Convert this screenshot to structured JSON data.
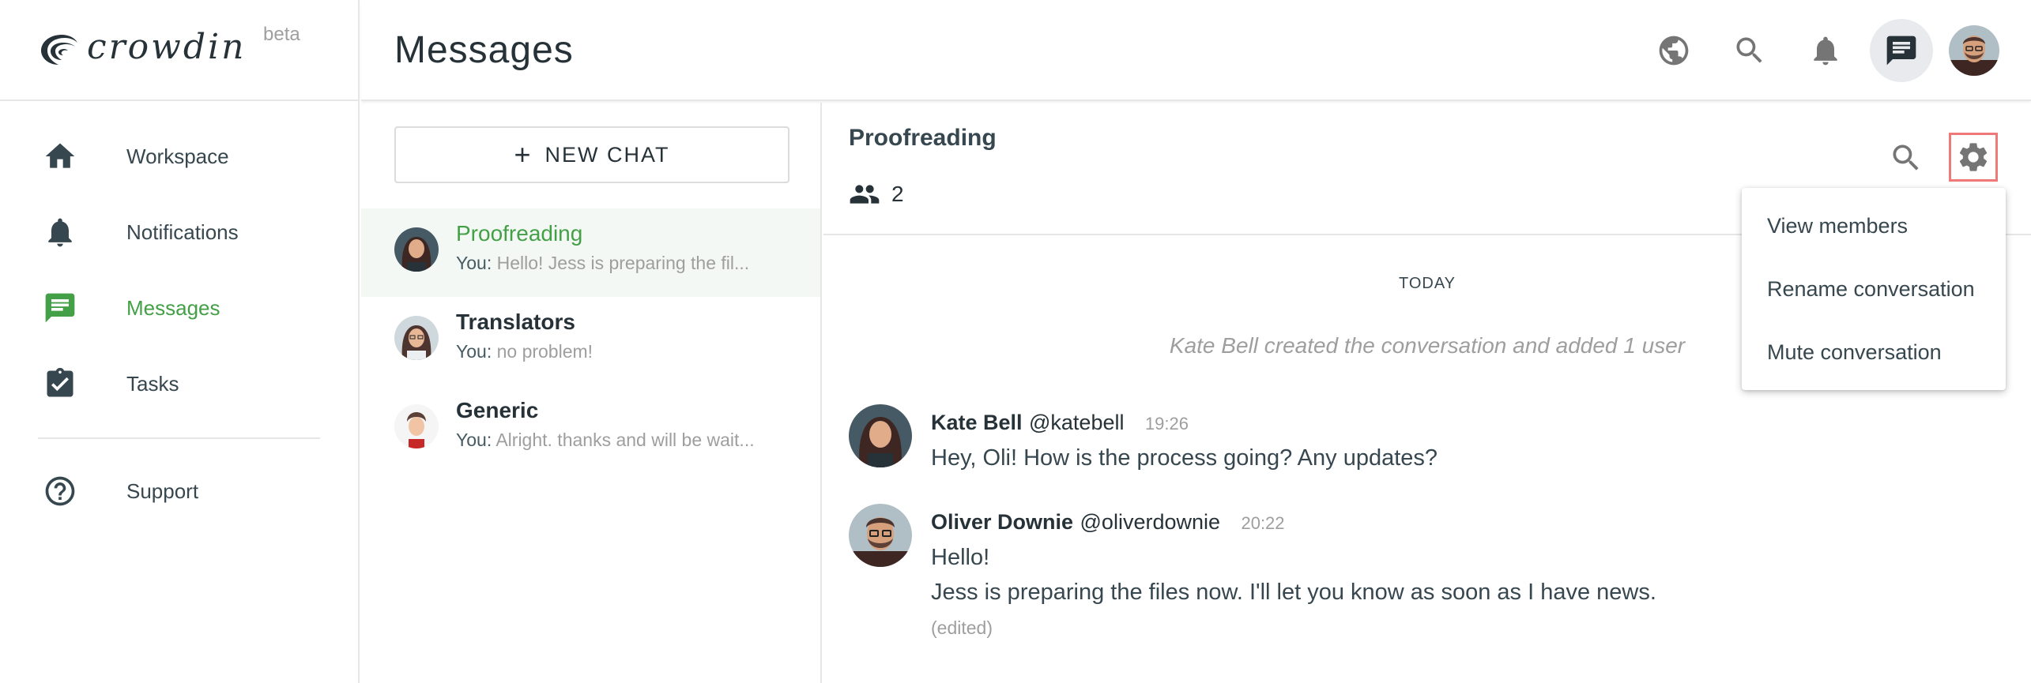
{
  "app": {
    "logo_text": "crowdin",
    "logo_badge": "beta"
  },
  "sidebar": {
    "items": [
      {
        "label": "Workspace",
        "icon": "home-icon"
      },
      {
        "label": "Notifications",
        "icon": "bell-icon"
      },
      {
        "label": "Messages",
        "icon": "chat-icon",
        "active": true
      },
      {
        "label": "Tasks",
        "icon": "clipboard-check-icon"
      },
      {
        "label": "Support",
        "icon": "help-circle-icon"
      }
    ]
  },
  "header": {
    "title": "Messages",
    "icons": [
      "globe-icon",
      "search-icon",
      "bell-icon",
      "chat-icon",
      "avatar"
    ]
  },
  "chatlist": {
    "new_chat_label": "NEW CHAT",
    "items": [
      {
        "title": "Proofreading",
        "you": "You:",
        "preview": "Hello! Jess is preparing the fil...",
        "active": true
      },
      {
        "title": "Translators",
        "you": "You:",
        "preview": "no problem!"
      },
      {
        "title": "Generic",
        "you": "You:",
        "preview": "Alright. thanks and will be wait..."
      }
    ]
  },
  "conversation": {
    "title": "Proofreading",
    "member_count": "2",
    "day_separator": "TODAY",
    "system_message": "Kate Bell created the conversation and added 1 user",
    "messages": [
      {
        "name": "Kate Bell",
        "handle": "@katebell",
        "time": "19:26",
        "lines": [
          "Hey, Oli! How is the process going? Any updates?"
        ]
      },
      {
        "name": "Oliver Downie",
        "handle": "@oliverdownie",
        "time": "20:22",
        "lines": [
          "Hello!",
          "Jess is preparing the files now. I'll let you know as soon as I have news."
        ],
        "edited": "(edited)"
      }
    ]
  },
  "settings_menu": {
    "items": [
      "View members",
      "Rename conversation",
      "Mute conversation"
    ]
  },
  "colors": {
    "accent": "#43a047",
    "text": "#263238",
    "muted": "#9e9e9e",
    "highlight_border": "#ef7878"
  }
}
